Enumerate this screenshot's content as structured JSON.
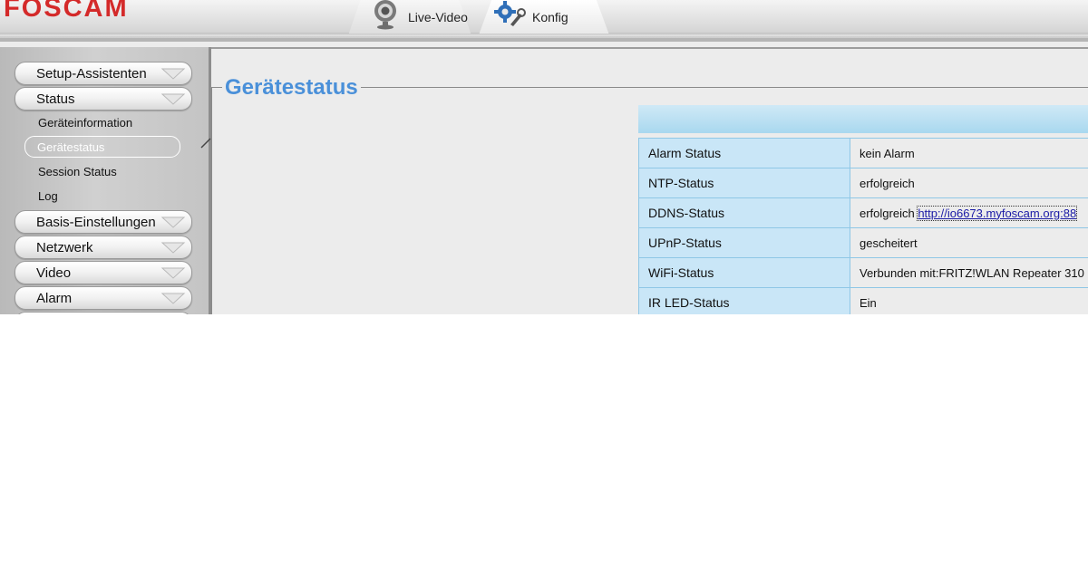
{
  "brand": {
    "logo_text": "FOSCAM",
    "logo_color": "#d42a2a",
    "accent": "#4a90d9"
  },
  "header": {
    "tabs": [
      {
        "label": "Live-Video",
        "icon": "webcam-icon"
      },
      {
        "label": "Konfig",
        "icon": "settings-tools-icon"
      }
    ]
  },
  "sidebar": {
    "menu": [
      {
        "label": "Setup-Assistenten"
      },
      {
        "label": "Status",
        "expanded": true
      },
      {
        "label": "Basis-Einstellungen"
      },
      {
        "label": "Netzwerk"
      },
      {
        "label": "Video"
      },
      {
        "label": "Alarm"
      }
    ],
    "status_submenu": [
      {
        "label": "Geräteinformation"
      },
      {
        "label": "Gerätestatus",
        "selected": true
      },
      {
        "label": "Session Status"
      },
      {
        "label": "Log"
      }
    ]
  },
  "main": {
    "title": "Gerätestatus",
    "rows": [
      {
        "key": "Alarm Status",
        "value": "kein Alarm"
      },
      {
        "key": "NTP-Status",
        "value": "erfolgreich"
      },
      {
        "key": "DDNS-Status",
        "value": "erfolgreich",
        "link": "http://io6673.myfoscam.org:88"
      },
      {
        "key": "UPnP-Status",
        "value": "gescheitert"
      },
      {
        "key": "WiFi-Status",
        "value": "Verbunden mit:FRITZ!WLAN Repeater 310"
      },
      {
        "key": "IR LED-Status",
        "value": "Ein"
      }
    ]
  }
}
